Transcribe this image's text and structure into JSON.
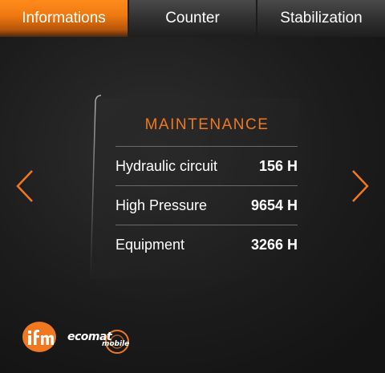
{
  "tabs": [
    {
      "label": "Informations",
      "active": true
    },
    {
      "label": "Counter",
      "active": false
    },
    {
      "label": "Stabilization",
      "active": false
    }
  ],
  "panel": {
    "title": "MAINTENANCE",
    "rows": [
      {
        "label": "Hydraulic circuit",
        "value": "156 H"
      },
      {
        "label": "High Pressure",
        "value": "9654 H"
      },
      {
        "label": "Equipment",
        "value": "3266 H"
      }
    ]
  },
  "navigation": {
    "prev_icon": "chevron-left-icon",
    "next_icon": "chevron-right-icon"
  },
  "branding": {
    "ifm_logo_text": "ifm",
    "ecomat_text": "ecomat",
    "ecomat_sub": "mobile"
  },
  "colors": {
    "accent": "#f07820",
    "tab_inactive": "#333333",
    "background": "#1c1c1c",
    "divider": "#6a6a6a"
  }
}
